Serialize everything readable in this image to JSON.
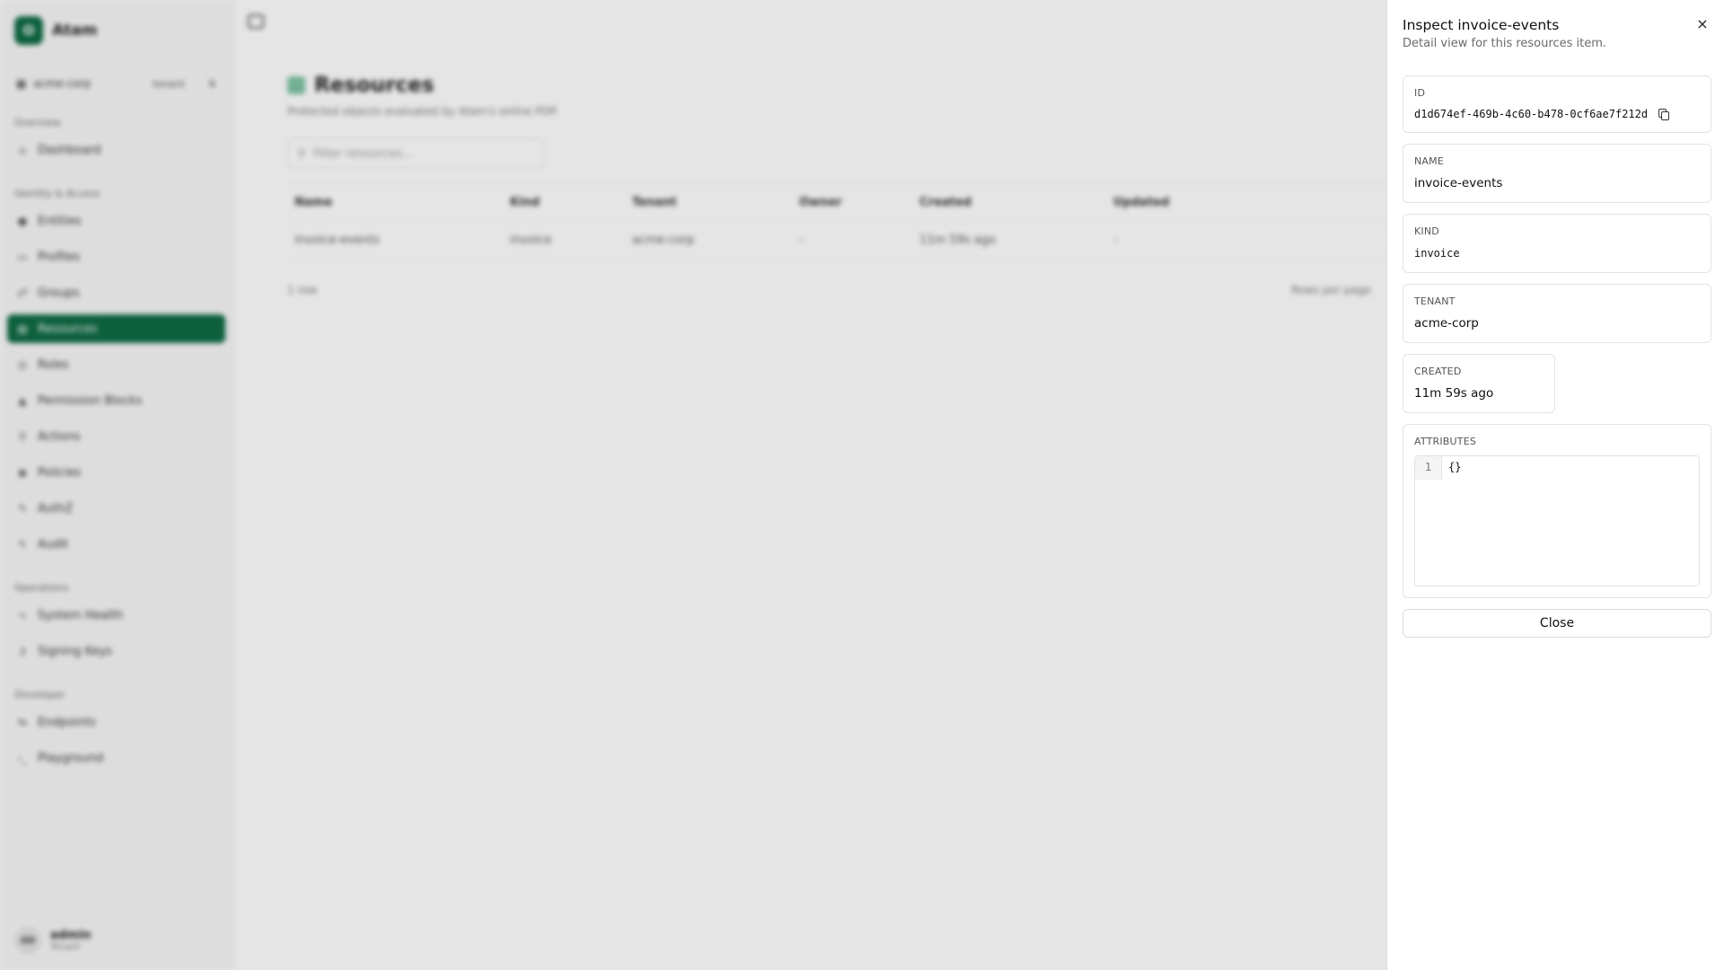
{
  "app": {
    "brand_initial": "O",
    "brand_name": "Atam",
    "tenant_name": "acme-corp",
    "tenant_badge": "tenant",
    "sections": {
      "overview": "Overview",
      "identity": "Identity & Access",
      "operations": "Operations",
      "developer": "Developer"
    },
    "nav": {
      "dashboard": "Dashboard",
      "entities": "Entities",
      "profiles": "Profiles",
      "groups": "Groups",
      "resources": "Resources",
      "roles": "Roles",
      "permission_blocks": "Permission Blocks",
      "actions": "Actions",
      "policies": "Policies",
      "authz": "AuthZ",
      "audit": "Audit",
      "system_health": "System Health",
      "signing_keys": "Signing Keys",
      "endpoints": "Endpoints",
      "playground": "Playground"
    },
    "user": {
      "initials": "AD",
      "name": "admin",
      "role": "Tenant"
    }
  },
  "page": {
    "title": "Resources",
    "subtitle": "Protected objects evaluated by Atam's online PDP.",
    "filter_placeholder": "Filter resources...",
    "columns": [
      "Name",
      "Kind",
      "Tenant",
      "Owner",
      "Created",
      "Updated"
    ],
    "rows": [
      [
        "invoice-events",
        "invoice",
        "acme-corp",
        "-",
        "11m 59s ago",
        "-"
      ]
    ],
    "row_count": "1 row",
    "rows_per_page": "Rows per page"
  },
  "drawer": {
    "title": "Inspect invoice-events",
    "description": "Detail view for this resources item.",
    "fields": {
      "id_label": "ID",
      "id_value": "d1d674ef-469b-4c60-b478-0cf6ae7f212d",
      "name_label": "NAME",
      "name_value": "invoice-events",
      "kind_label": "KIND",
      "kind_value": "invoice",
      "tenant_label": "TENANT",
      "tenant_value": "acme-corp",
      "created_label": "CREATED",
      "created_value": "11m 59s ago",
      "attributes_label": "ATTRIBUTES",
      "attributes_line_no": "1",
      "attributes_code": "{}"
    },
    "close_label": "Close",
    "close_icon": "×"
  },
  "colors": {
    "brand": "#0f6b45",
    "overlay": "rgba(0,0,0,0.10)"
  },
  "icons": [
    "close-icon",
    "copy-icon",
    "search-icon",
    "sidebar-toggle-icon",
    "chevron-icon"
  ]
}
